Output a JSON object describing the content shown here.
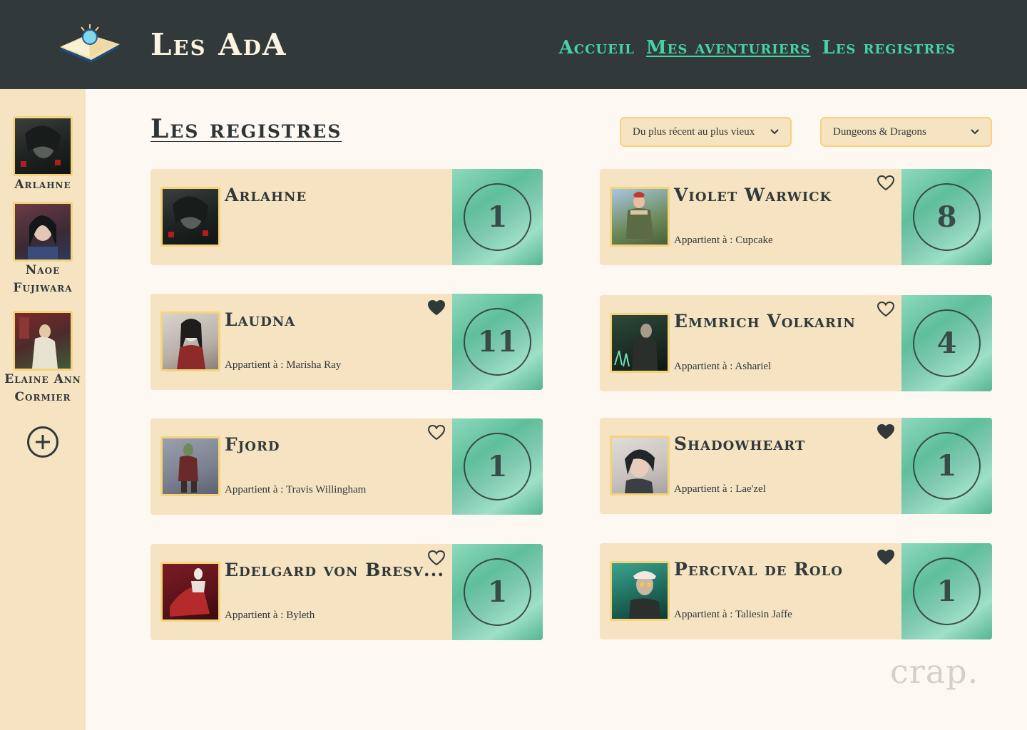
{
  "header": {
    "title": "Les AdA",
    "nav": [
      "Accueil",
      "Mes aventuriers",
      "Les registres"
    ]
  },
  "sidebar": {
    "items": [
      {
        "name": "Arlahne"
      },
      {
        "name": "Naoe Fujiwara"
      },
      {
        "name": "Elaine Ann Cormier"
      }
    ]
  },
  "main": {
    "title": "Les registres",
    "sort_select": "Du plus récent au plus vieux",
    "game_select": "Dungeons & Dragons"
  },
  "cards": [
    {
      "name": "Arlahne",
      "owner": "",
      "level": "1",
      "favorite": "none"
    },
    {
      "name": "Violet Warwick",
      "owner": "Appartient à : Cupcake",
      "level": "8",
      "favorite": "outline"
    },
    {
      "name": "Laudna",
      "owner": "Appartient à : Marisha Ray",
      "level": "11",
      "favorite": "filled"
    },
    {
      "name": "Emmrich Volkarin",
      "owner": "Appartient à : Ashariel",
      "level": "4",
      "favorite": "outline"
    },
    {
      "name": "Fjord",
      "owner": "Appartient à : Travis Willingham",
      "level": "1",
      "favorite": "outline"
    },
    {
      "name": "Shadowheart",
      "owner": "Appartient à : Lae'zel",
      "level": "1",
      "favorite": "filled"
    },
    {
      "name": "Edelgard von Bresv...",
      "owner": "Appartient à : Byleth",
      "level": "1",
      "favorite": "outline"
    },
    {
      "name": "Percival de Rolo",
      "owner": "Appartient à : Taliesin Jaffe",
      "level": "1",
      "favorite": "filled"
    }
  ],
  "watermark": "crap.",
  "colors": {
    "header": "#31393a",
    "accent": "#45d3a2",
    "card": "#f5e3c1",
    "border": "#f4d37d"
  }
}
